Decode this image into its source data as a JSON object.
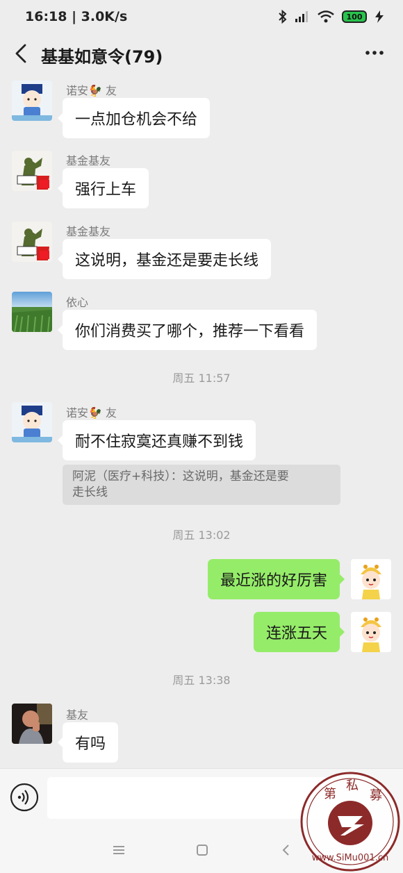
{
  "status_bar": {
    "time": "16:18 | 3.0K/s",
    "battery": "100"
  },
  "title_bar": {
    "title": "基基如意令(79)"
  },
  "messages": [
    {
      "sender": "诺安🐓 友",
      "text": "一点加仓机会不给",
      "avatar": "baby-cartoon-avatar"
    },
    {
      "sender": "基金基友",
      "text": "强行上车",
      "avatar": "salute-soldier-avatar"
    },
    {
      "sender": "基金基友",
      "text": "这说明，基金还是要走长线",
      "avatar": "salute-soldier-avatar"
    },
    {
      "sender": "依心",
      "text": "你们消费买了哪个，推荐一下看看",
      "avatar": "landscape-avatar"
    },
    {
      "sender": "诺安🐓 友",
      "text": "耐不住寂寞还真赚不到钱",
      "avatar": "baby-cartoon-avatar",
      "quote": {
        "line1": "阿泥（医疗+科技）：这说明，基金还是要",
        "line2": "走长线"
      }
    },
    {
      "text": "最近涨的好厉害",
      "avatar": "cartoon-girl-avatar"
    },
    {
      "text": "连涨五天",
      "avatar": "cartoon-girl-avatar"
    },
    {
      "sender": "基友",
      "text": "有吗",
      "avatar": "person-photo-avatar"
    }
  ],
  "timestamps": [
    "周五 11:57",
    "周五 13:02",
    "周五 13:38"
  ],
  "watermark": {
    "chars": [
      "第",
      "私",
      "募"
    ],
    "url": "www.SiMu001.cn"
  },
  "colors": {
    "background": "#ededed",
    "bubble_self": "#95ec69",
    "bubble_other": "#ffffff",
    "watermark": "#8c2a2a"
  }
}
